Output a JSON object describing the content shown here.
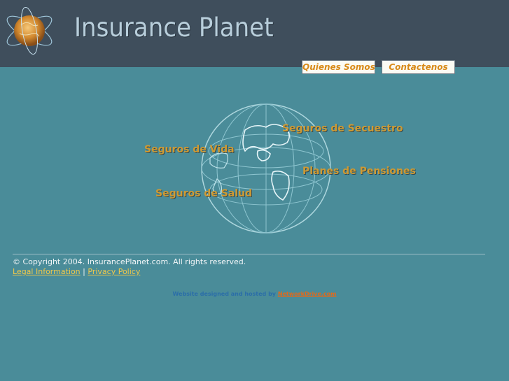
{
  "header": {
    "title": "Insurance Planet",
    "logo_icon": "globe-atom-icon",
    "background": "#3f4e5c"
  },
  "nav": {
    "about_label": "Quienes Somos",
    "contact_label": "Contactenos"
  },
  "main": {
    "globe_icon": "world-globe-icon",
    "links": {
      "secuestro": "Seguros de Secuestro",
      "vida": "Seguros de Vida",
      "pensiones": "Planes de Pensiones",
      "salud": "Seguros de Salud"
    }
  },
  "footer": {
    "copyright": "© Copyright 2004. InsurancePlanet.com. All rights reserved.",
    "legal_label": "Legal Information",
    "separator": "|",
    "privacy_label": "Privacy Policy",
    "credit_text": "Website designed and hosted by",
    "credit_link": "NetworkDrive.com"
  },
  "colors": {
    "page_background": "#4a8c99",
    "link_gold": "#cf9a33",
    "footer_link": "#f0c84a"
  }
}
